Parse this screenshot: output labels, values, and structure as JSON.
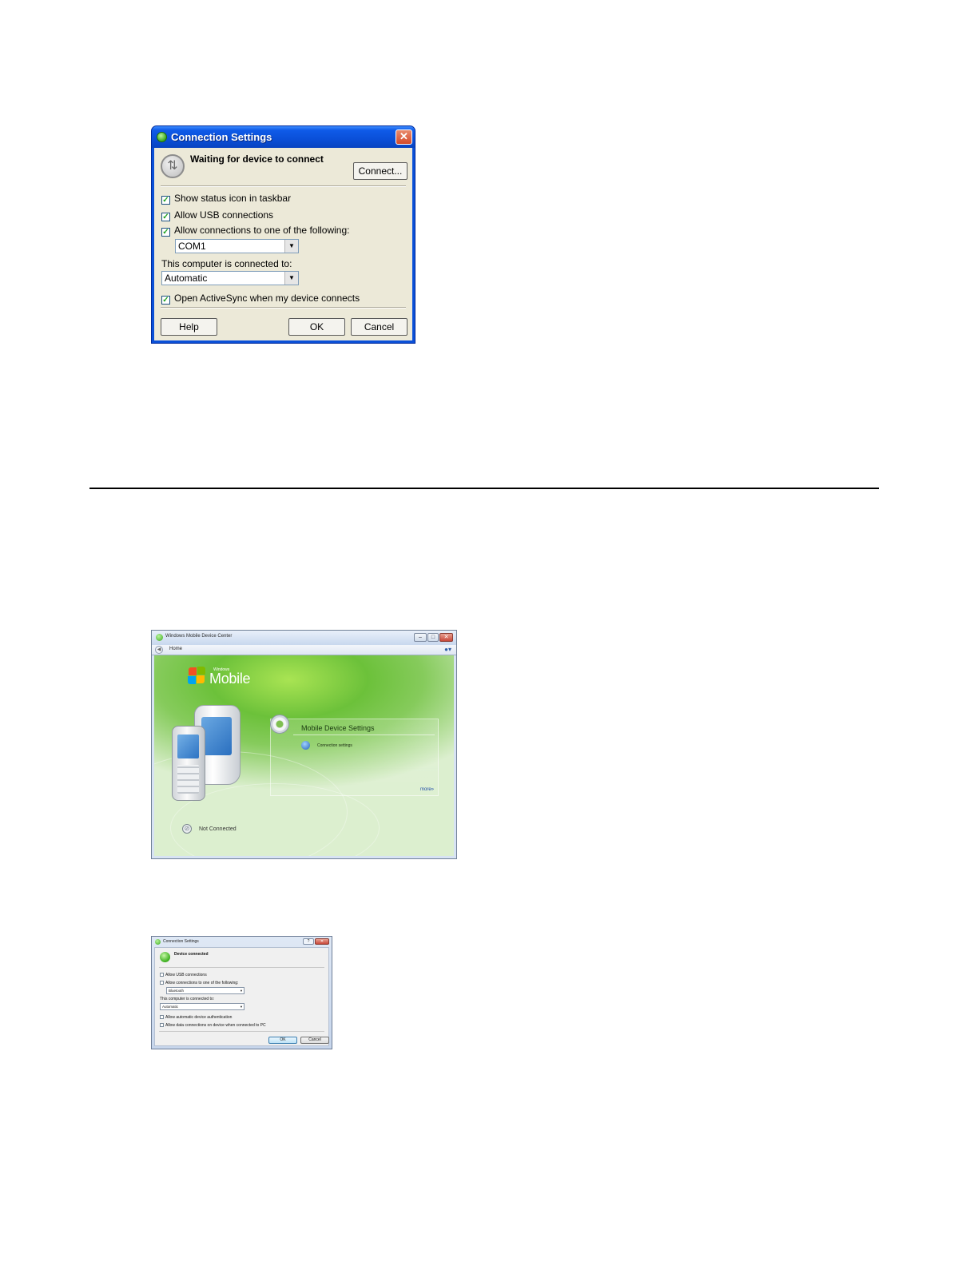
{
  "xp_dialog": {
    "title": "Connection Settings",
    "close_glyph": "✕",
    "status": "Waiting for device to connect",
    "connect_label": "Connect...",
    "options": [
      {
        "label": "Show status icon in taskbar",
        "checked": true
      },
      {
        "label": "Allow USB connections",
        "checked": true
      },
      {
        "label": "Allow connections to one of the following:",
        "checked": true
      }
    ],
    "port_value": "COM1",
    "connected_to_label": "This computer is connected to:",
    "connected_to_value": "Automatic",
    "open_activesync": {
      "label": "Open ActiveSync when my device connects",
      "checked": true
    },
    "help_label": "Help",
    "ok_label": "OK",
    "cancel_label": "Cancel",
    "check_glyph": "✓",
    "icons": [
      "sync-status-icon",
      "close-icon",
      "chevron-down-icon"
    ]
  },
  "wmdc_window": {
    "title": "Windows Mobile Device Center",
    "nav_home": "Home",
    "brand_small": "Windows",
    "brand_large": "Mobile",
    "panel_title": "Mobile Device Settings",
    "panel_link": "Connection settings",
    "more_link": "more»",
    "status": "Not Connected",
    "back_glyph": "◀",
    "help_glyph": "●▾",
    "min_glyph": "–",
    "max_glyph": "□",
    "close_glyph": "✕",
    "block_glyph": "⊘"
  },
  "vista_dialog": {
    "title": "Connection Settings",
    "help_glyph": "?",
    "close_glyph": "✕",
    "status": "Device connected",
    "options": [
      {
        "label": "Allow USB connections",
        "checked": true
      },
      {
        "label": "Allow connections to one of the following:",
        "checked": true
      }
    ],
    "port_value": "Bluetooth",
    "connected_to_label": "This computer is connected to:",
    "connected_to_value": "Automatic",
    "extra_options": [
      {
        "label": "Allow automatic device authentication",
        "checked": true
      },
      {
        "label": "Allow data connections on device when connected to PC",
        "checked": true
      }
    ],
    "ok_label": "OK",
    "cancel_label": "Cancel",
    "check_glyph": "✓",
    "dropdown_glyph": "▼"
  },
  "colors": {
    "xp_title_blue": "#0a4fd8",
    "xp_face": "#ece9d8",
    "wm_green": "#6cc13a",
    "vista_frame": "#c7d6ec"
  }
}
